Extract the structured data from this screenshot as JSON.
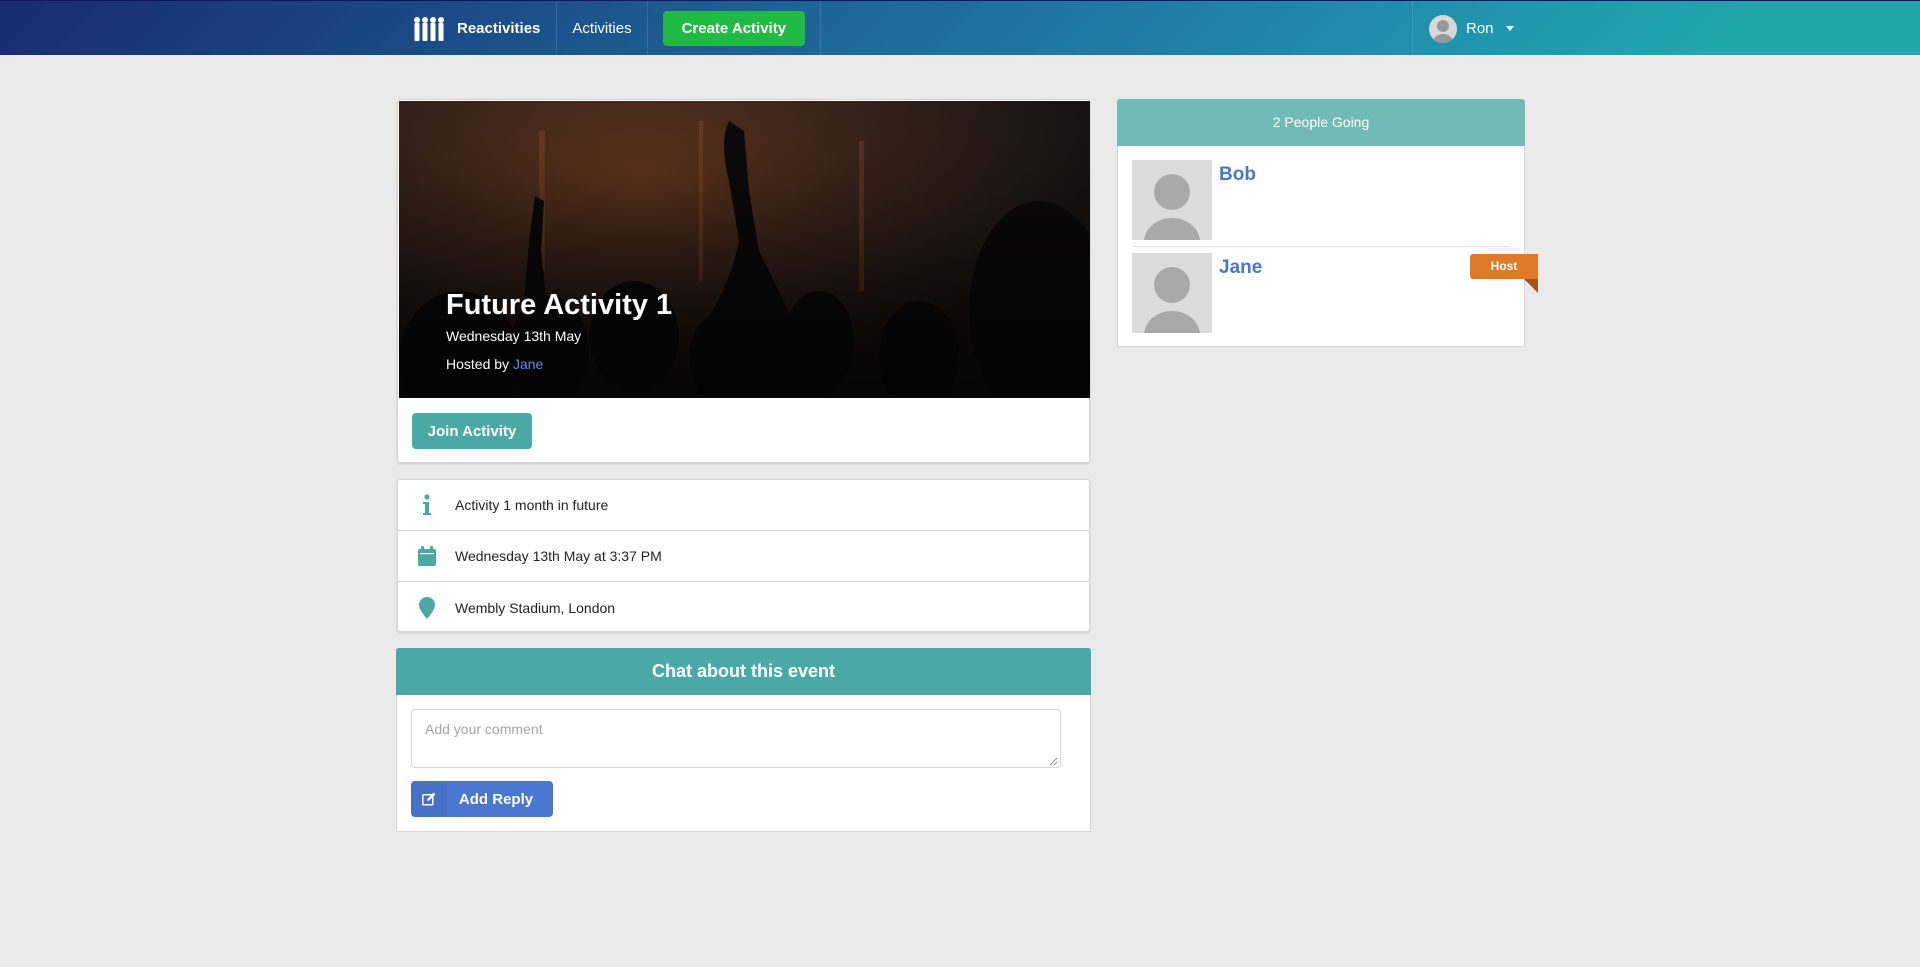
{
  "navbar": {
    "brand": "Reactivities",
    "activities_link": "Activities",
    "create_button": "Create Activity",
    "user_name": "Ron"
  },
  "activity": {
    "title": "Future Activity 1",
    "date": "Wednesday 13th May",
    "hosted_by_label": "Hosted by",
    "host_name": "Jane",
    "join_button": "Join Activity",
    "details": {
      "description": "Activity 1 month in future",
      "datetime": "Wednesday 13th May at 3:37 PM",
      "venue": "Wembly Stadium, London"
    }
  },
  "chat": {
    "header": "Chat about this event",
    "placeholder": "Add your comment",
    "reply_button": "Add Reply"
  },
  "sidebar": {
    "header": "2 People Going",
    "attendees": [
      {
        "name": "Bob"
      },
      {
        "name": "Jane"
      }
    ],
    "host_badge": "Host"
  },
  "colors": {
    "accent_teal": "#4aa9a4",
    "create_green": "#21ba45",
    "reply_blue": "#4a78d0",
    "host_orange": "#e07a27",
    "link_blue": "#4a78c2"
  }
}
